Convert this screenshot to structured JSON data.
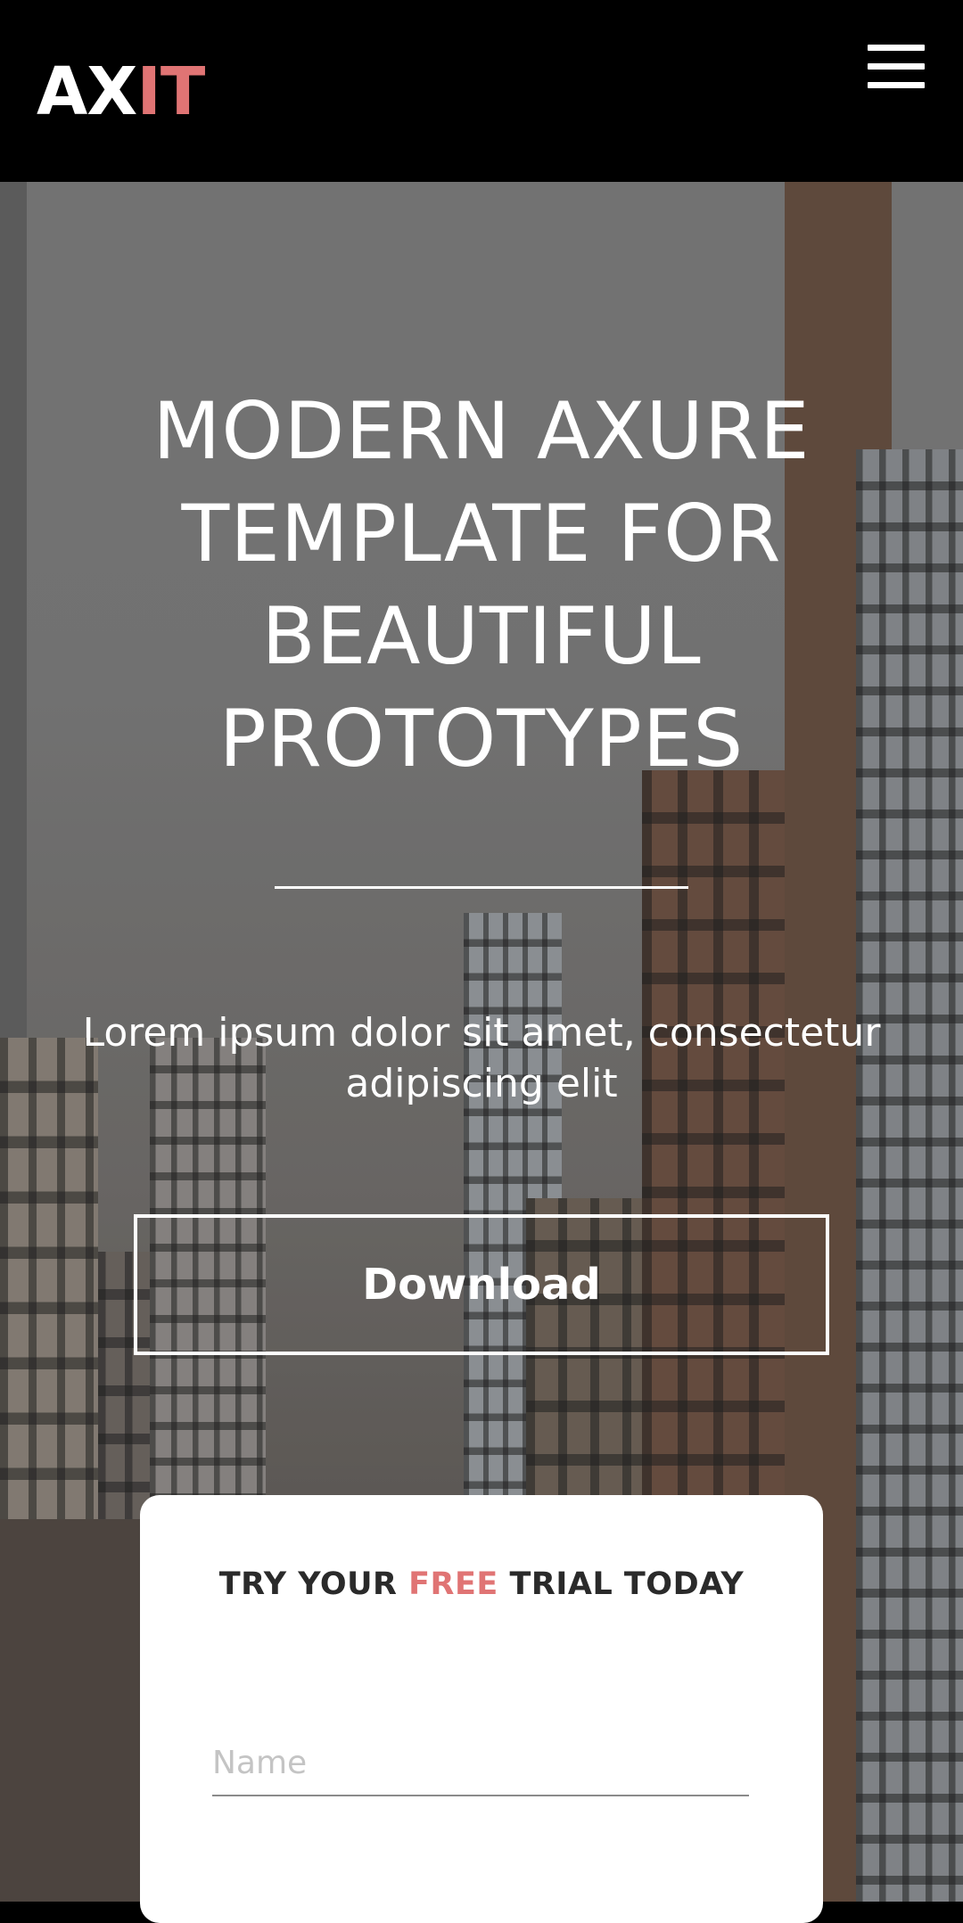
{
  "header": {
    "logo_part1": "AX",
    "logo_part2": "IT",
    "menu_icon": "hamburger-menu-icon"
  },
  "hero": {
    "headline": "MODERN AXURE TEMPLATE FOR BEAUTIFUL PROTOTYPES",
    "subtext": "Lorem ipsum dolor sit amet, consectetur adipiscing elit",
    "download_label": "Download"
  },
  "trial": {
    "title_before": "TRY YOUR ",
    "title_highlight": "FREE",
    "title_after": " TRIAL TODAY",
    "name_placeholder": "Name"
  },
  "colors": {
    "accent": "#e07474",
    "header_bg": "#000000",
    "text_on_dark": "#ffffff"
  }
}
